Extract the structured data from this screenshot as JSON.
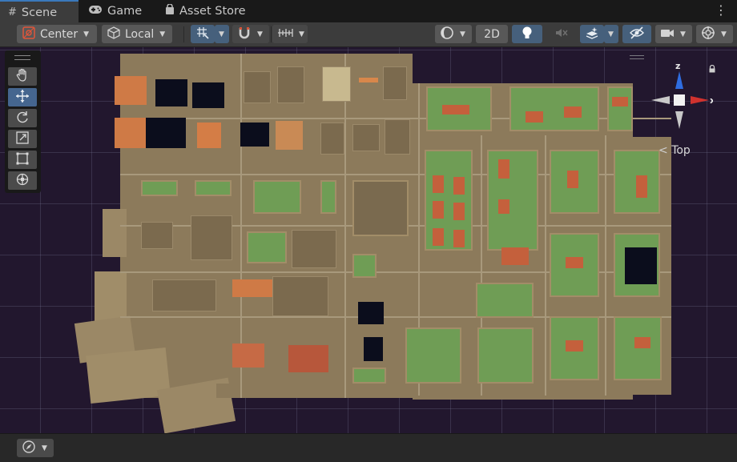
{
  "tabs": [
    {
      "label": "Scene",
      "icon": "hash-icon",
      "active": true
    },
    {
      "label": "Game",
      "icon": "gamepad-icon",
      "active": false
    },
    {
      "label": "Asset Store",
      "icon": "shopping-bag-icon",
      "active": false
    }
  ],
  "toolbar": {
    "pivot_mode": "Center",
    "pivot_rotation": "Local",
    "mode_2d": "2D"
  },
  "gizmo": {
    "view_label": "Top",
    "axis_z": "z",
    "axis_x": "x"
  },
  "colors": {
    "active_tab_border": "#3a79bb",
    "active_button": "#46607c",
    "viewport_background": "#22172e",
    "axis_x": "#d0322e",
    "axis_z": "#2f6de0",
    "ground": "#8c7a5b",
    "grass": "#6f9d55",
    "roof": "#c4603c"
  }
}
